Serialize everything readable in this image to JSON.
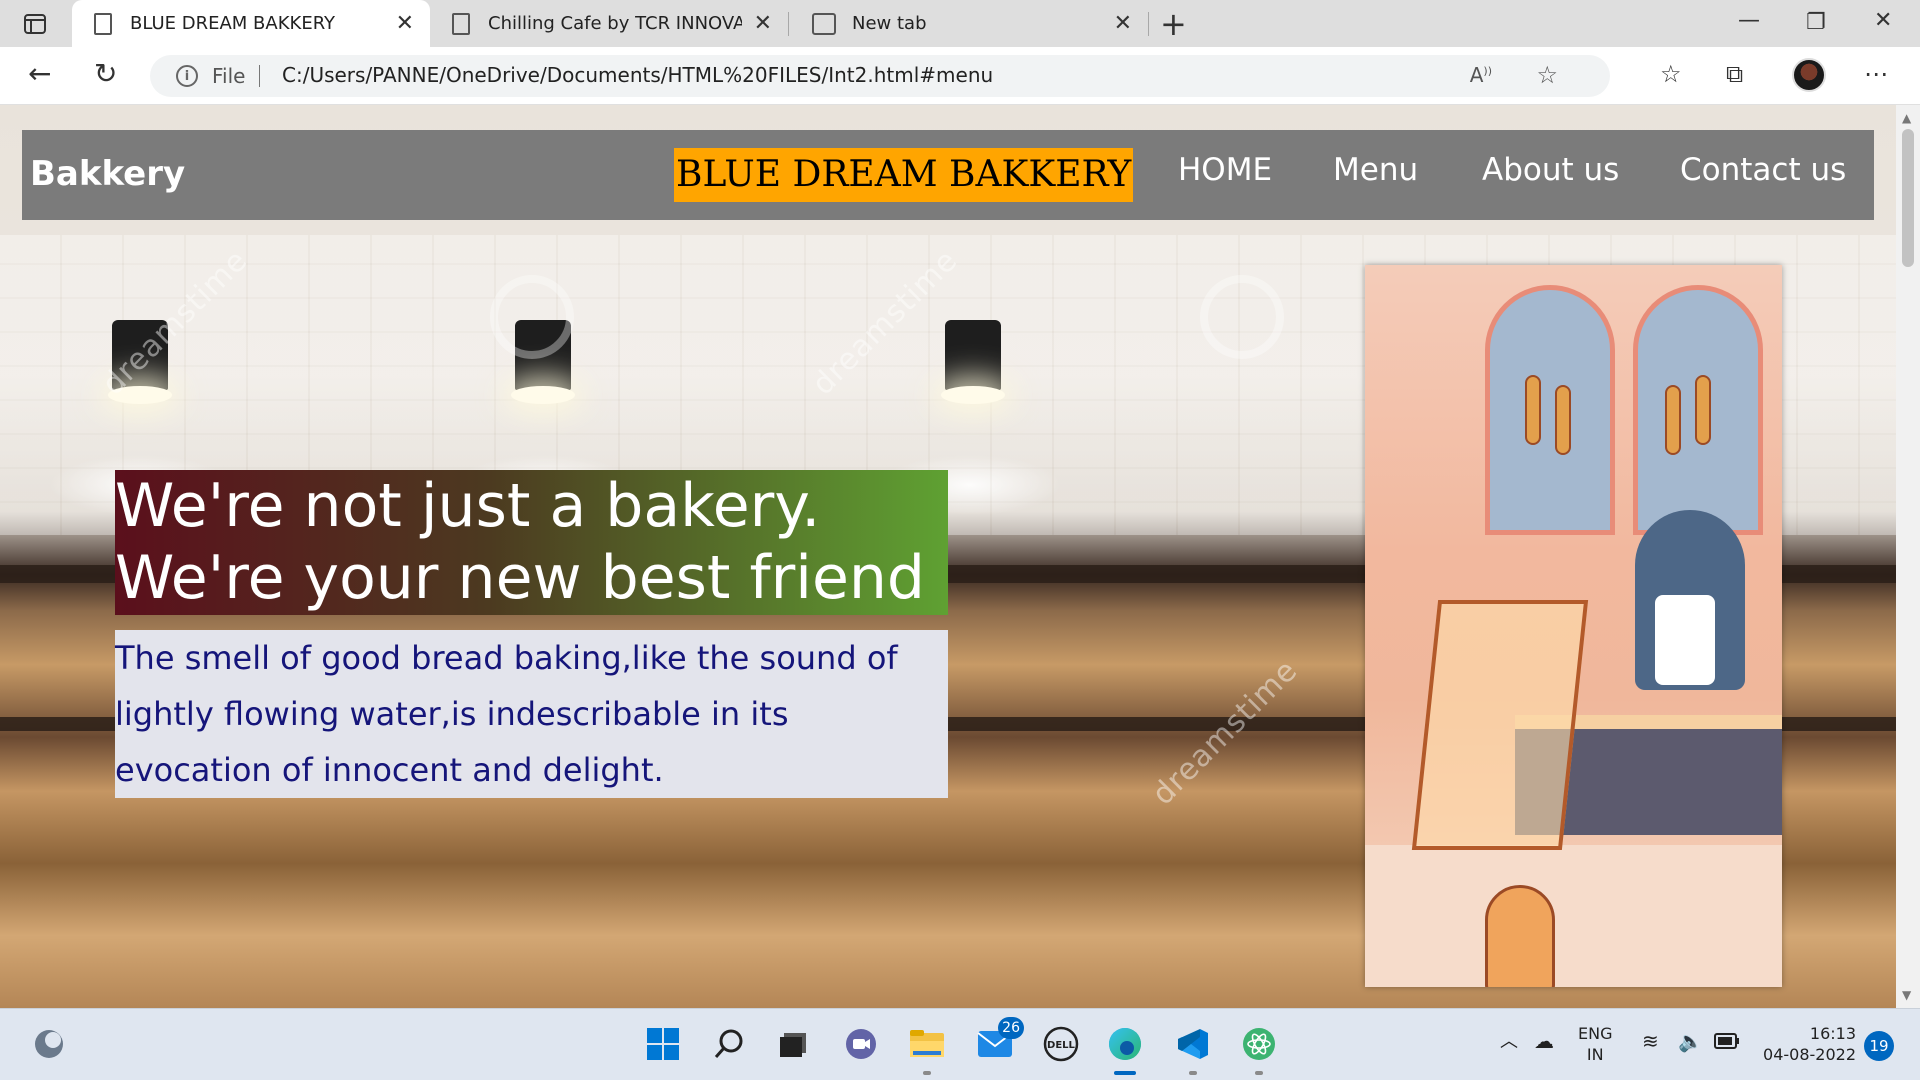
{
  "browser": {
    "tabs": [
      {
        "title": "BLUE DREAM BAKKERY",
        "active": true
      },
      {
        "title": "Chilling Cafe by TCR INNOVATIO",
        "active": false
      },
      {
        "title": "New tab",
        "active": false
      }
    ],
    "address": {
      "scheme_label": "File",
      "url": "C:/Users/PANNE/OneDrive/Documents/HTML%20FILES/Int2.html#menu"
    },
    "icons": [
      "back-icon",
      "refresh-icon",
      "info-icon",
      "read-aloud-icon",
      "add-favorite-icon",
      "favorites-icon",
      "collections-icon",
      "profile-avatar",
      "more-icon"
    ]
  },
  "site": {
    "brand": "Bakkery",
    "title": "BLUE DREAM BAKKERY",
    "nav": [
      "HOME",
      "Menu",
      "About us",
      "Contact us"
    ],
    "hero": {
      "line1": "We're not just a bakery.",
      "line2": "We're your new best friend",
      "body": "The smell of good bread baking,like the sound of lightly flowing water,is indescribable in its evocation of innocent and delight."
    },
    "watermark": "dreamstime",
    "colors": {
      "nav_bg": "#7b7b7b",
      "title_bg": "#ffa500",
      "hero_gradient_start": "#5b0f1c",
      "hero_gradient_end": "#5fa132",
      "body_text": "#15157a"
    }
  },
  "taskbar": {
    "mail_badge": "26",
    "language_line1": "ENG",
    "language_line2": "IN",
    "time": "16:13",
    "date": "04-08-2022",
    "notifications": "19"
  }
}
